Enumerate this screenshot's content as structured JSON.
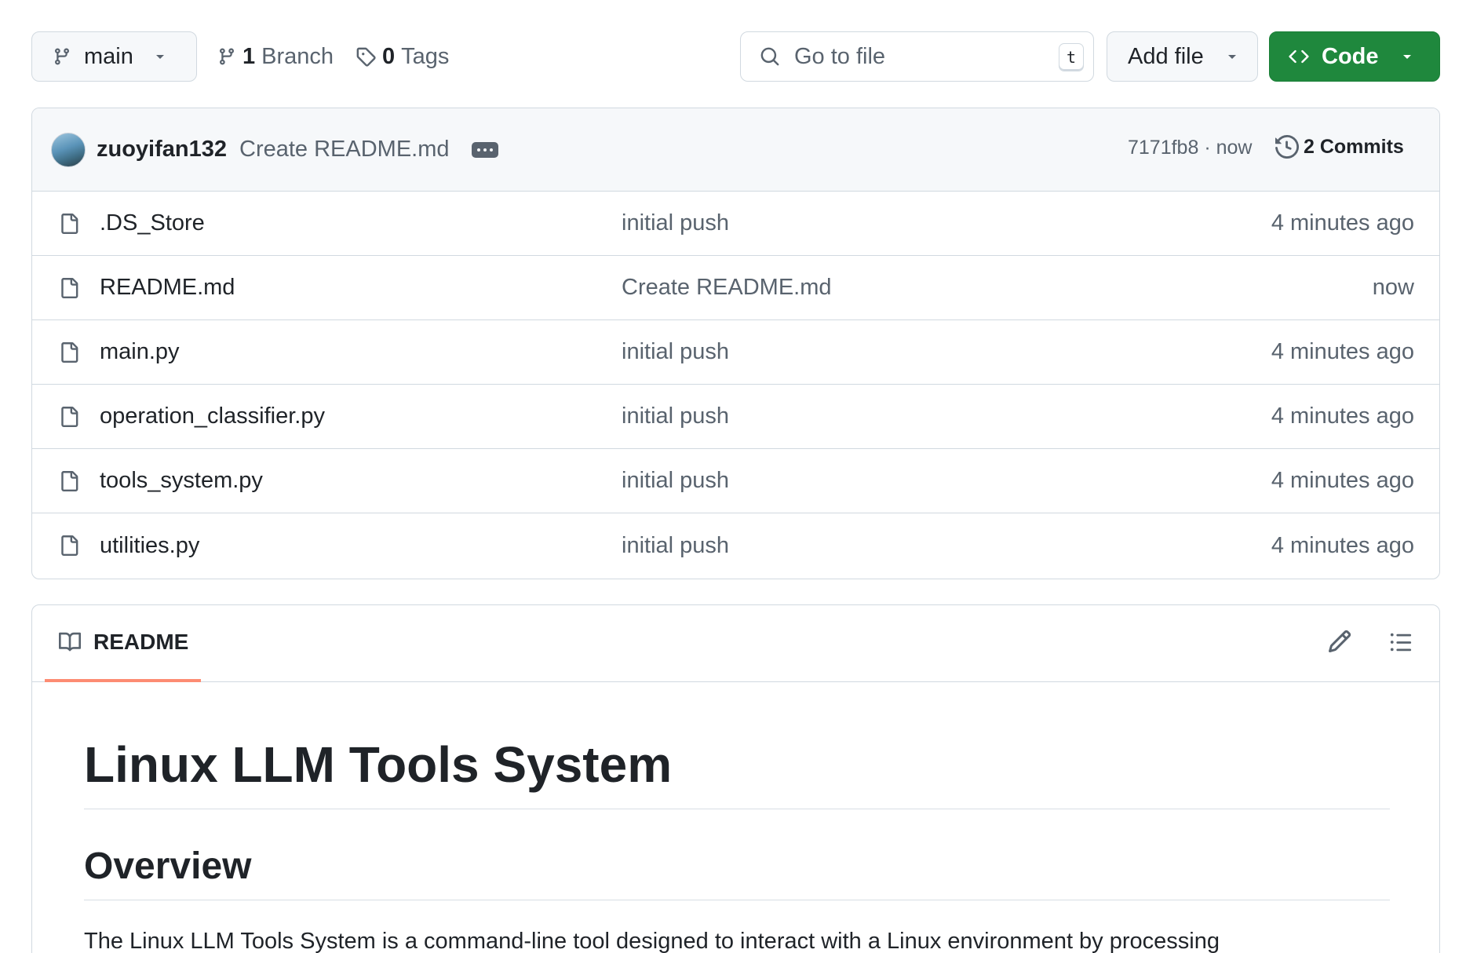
{
  "toolbar": {
    "branch": "main",
    "branches_count": "1",
    "branches_label": "Branch",
    "tags_count": "0",
    "tags_label": "Tags",
    "search_placeholder": "Go to file",
    "search_shortcut": "t",
    "add_file_label": "Add file",
    "code_label": "Code"
  },
  "latest_commit": {
    "author": "zuoyifan132",
    "message": "Create README.md",
    "sha": "7171fb8",
    "time": "now",
    "commits_label": "2 Commits"
  },
  "files": [
    {
      "name": ".DS_Store",
      "message": "initial push",
      "time": "4 minutes ago"
    },
    {
      "name": "README.md",
      "message": "Create README.md",
      "time": "now"
    },
    {
      "name": "main.py",
      "message": "initial push",
      "time": "4 minutes ago"
    },
    {
      "name": "operation_classifier.py",
      "message": "initial push",
      "time": "4 minutes ago"
    },
    {
      "name": "tools_system.py",
      "message": "initial push",
      "time": "4 minutes ago"
    },
    {
      "name": "utilities.py",
      "message": "initial push",
      "time": "4 minutes ago"
    }
  ],
  "readme": {
    "tab_label": "README",
    "title": "Linux LLM Tools System",
    "overview_heading": "Overview",
    "overview_text": "The Linux LLM Tools System is a command-line tool designed to interact with a Linux environment by processing"
  },
  "colors": {
    "accent_green": "#1f883d",
    "tab_underline": "#fd8c73",
    "muted_text": "#59636e",
    "border": "#d1d9e0"
  },
  "icons": {
    "branch": "git-branch-icon",
    "tag": "tag-icon",
    "search": "search-icon",
    "code": "code-icon",
    "history": "history-icon",
    "file": "file-icon",
    "book": "book-icon",
    "pencil": "pencil-icon",
    "list": "list-unordered-icon"
  }
}
